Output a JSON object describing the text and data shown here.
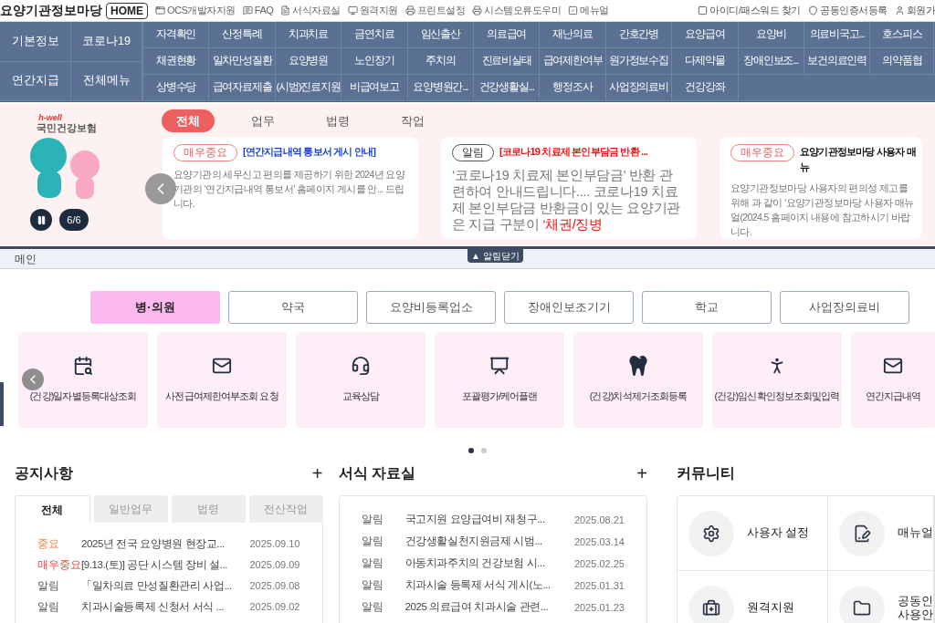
{
  "header": {
    "site_title": "요양기관정보마당",
    "home": "HOME",
    "links": [
      "OCS개발자지원",
      "FAQ",
      "서식자료실",
      "원격지원",
      "프린트설정",
      "시스템오류도우미",
      "메뉴얼"
    ],
    "right_links": [
      "아이디/패스워드 찾기",
      "공동인증서등록",
      "회원가"
    ]
  },
  "nav": {
    "main": [
      [
        "기본정보",
        "코로나19"
      ],
      [
        "연간지급",
        "전체메뉴"
      ]
    ],
    "items": [
      [
        "자격확인",
        "산정특례",
        "치과치료",
        "금연치료",
        "임신출산",
        "의료급여",
        "재난의료",
        "간호간병",
        "요양급여",
        "요양비",
        "의료비국고...",
        "호스피스"
      ],
      [
        "채권현황",
        "일차만성질환",
        "요양병원",
        "노인장기",
        "주치의",
        "진료비실태",
        "급여제한여부",
        "원가정보수집",
        "다제약물",
        "장애인보조...",
        "보건의료인력",
        "의약품협"
      ],
      [
        "상병수당",
        "급여자료제출",
        "(시범)진료지원",
        "비급여보고",
        "요양병원간...",
        "건강생활실...",
        "행정조사",
        "사업장의료비",
        "건강강좌"
      ]
    ]
  },
  "banner": {
    "logo_small": "h-well",
    "logo": "국민건강보험",
    "counter": "6/6",
    "tabs": [
      {
        "label": "전체",
        "selected": true
      },
      {
        "label": "업무",
        "selected": false
      },
      {
        "label": "법령",
        "selected": false
      },
      {
        "label": "작업",
        "selected": false
      }
    ],
    "cards": [
      {
        "badge": "매우중요",
        "kind": "urgent",
        "title": "[연간지급내역 통보서 게시 안내]",
        "color": "#1a3fd8",
        "body": "요양기관의 세무신고 편의를 제공하기 위한 2024년 요양기관의 ‘연간지급내역 통보서’ 홈페이지 게시를 안... 드립니다."
      },
      {
        "badge": "알림",
        "kind": "notice",
        "title": "[코로나19 치료제 본인부담금 반환 ...",
        "color": "#ee1111",
        "body": "‘코로나19 치료제 본인부담금’ 반환 관련하여 안내드립니다.... 코로나19 치료제 본인부담금 반환금이 있는 요양기관은 지급 구분이 ",
        "body_red": "‘채권/징병"
      },
      {
        "badge": "매우중요",
        "kind": "urgent",
        "title": "요양기관정보마당 사용자 매뉴",
        "color": "#111111",
        "body": "요양기관정보마당 사용자의 편의성 제고를 위해 과 같이 ‘요양기관정보마당 사용자 매뉴얼(2024.5 홈페이지 내용에 참고하시기 바랍니다."
      }
    ],
    "close": "▲ 알림닫기"
  },
  "breadcrumb": "메인",
  "categories": [
    {
      "label": "병·의원",
      "selected": true
    },
    {
      "label": "약국",
      "selected": false
    },
    {
      "label": "요양비등록업소",
      "selected": false
    },
    {
      "label": "장애인보조기기",
      "selected": false
    },
    {
      "label": "학교",
      "selected": false
    },
    {
      "label": "사업장의료비",
      "selected": false
    }
  ],
  "quick_menu": [
    "(건강)일자별등록대상조회",
    "사전급여제한여부조회 요청",
    "교육상담",
    "포괄평가/케어플랜",
    "(건강)치석제거조회등록",
    "(건강)임신확인정보조회및입력",
    "연간지급내역"
  ],
  "pager": [
    {
      "selected": true
    },
    {
      "selected": false
    }
  ],
  "notices": {
    "title": "공지사항",
    "more": "+",
    "tabs": [
      {
        "label": "전체",
        "selected": true
      },
      {
        "label": "일반업무",
        "selected": false
      },
      {
        "label": "법령",
        "selected": false
      },
      {
        "label": "전산작업",
        "selected": false
      }
    ],
    "rows": [
      {
        "tag": "중요",
        "kind": "important",
        "title": "2025년 전국 요양병원 현장교...",
        "date": "2025.09.10"
      },
      {
        "tag": "매우중요",
        "kind": "urgent",
        "title": "[9.13.(토)] 공단 시스템 장비 설...",
        "date": "2025.09.09"
      },
      {
        "tag": "알림",
        "kind": "notice",
        "title": "「일차의료 만성질환관리 사업...",
        "date": "2025.09.08"
      },
      {
        "tag": "알림",
        "kind": "notice",
        "title": "치과시술등록제 신청서 서식 ...",
        "date": "2025.09.02"
      }
    ]
  },
  "forms": {
    "title": "서식 자료실",
    "more": "+",
    "rows": [
      {
        "tag": "알림",
        "title": "국고지원 요양급여비 재청구...",
        "date": "2025.08.21"
      },
      {
        "tag": "알림",
        "title": "건강생활실천지원금제 시범...",
        "date": "2025.03.14"
      },
      {
        "tag": "알림",
        "title": "아동치과주치의 건강보험 시...",
        "date": "2025.02.25"
      },
      {
        "tag": "알림",
        "title": "치과시술 등록제 서식 게시(노...",
        "date": "2025.01.31"
      },
      {
        "tag": "알림",
        "title": "2025 의료급여 치과시술 관련...",
        "date": "2025.01.23"
      }
    ]
  },
  "community": {
    "title": "커뮤니티",
    "items": [
      [
        "사용자 설정"
      ],
      [
        "매뉴얼"
      ],
      [
        "원격지원"
      ],
      [
        "공동인",
        "사용안"
      ]
    ]
  }
}
